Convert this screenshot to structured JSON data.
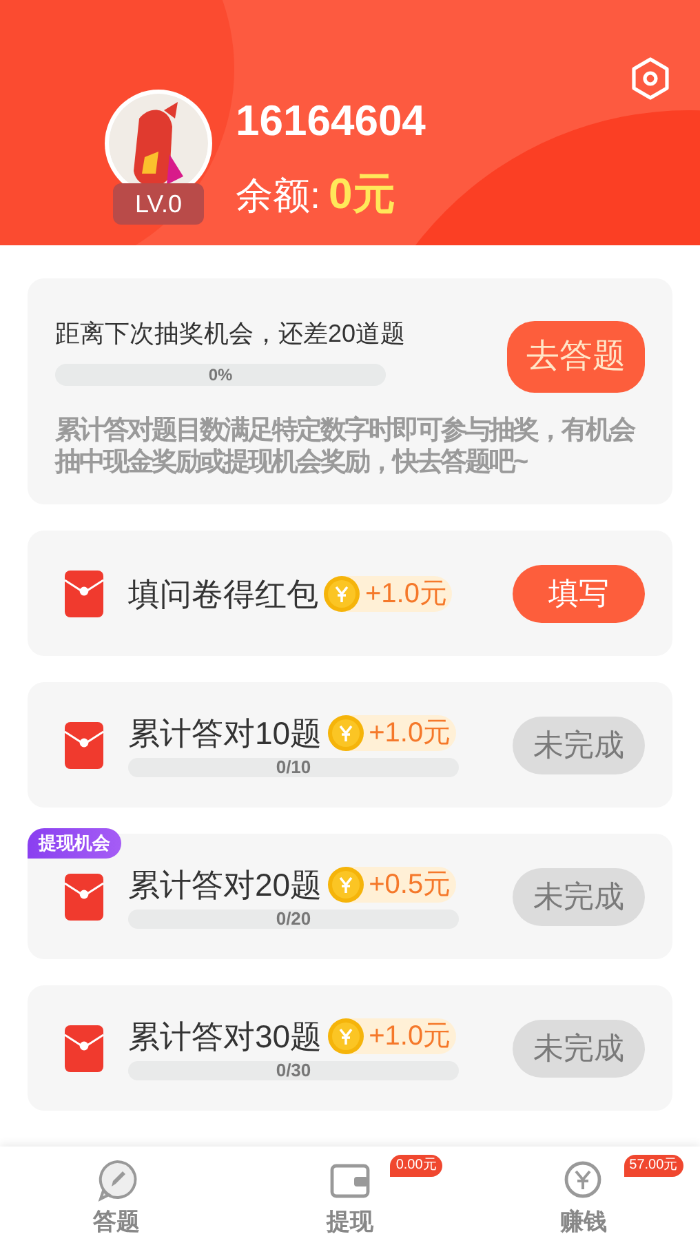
{
  "profile": {
    "user_id": "16164604",
    "level_badge": "LV.0",
    "balance_label": "余额:",
    "balance_value": "0元"
  },
  "lottery": {
    "title": "距离下次抽奖机会，还差20道题",
    "progress_text": "0%",
    "level": 0,
    "button": "去答题",
    "description": "累计答对题目数满足特定数字时即可参与抽奖，有机会抽中现金奖励或提现机会奖励，快去答题吧~"
  },
  "tasks": [
    {
      "kind": "survey",
      "title": "填问卷得红包",
      "reward": "+1.0元",
      "button": "填写",
      "disabled": false
    },
    {
      "kind": "progress",
      "title": "累计答对10题",
      "reward": "+1.0元",
      "progress_text": "0/10",
      "level": 0,
      "button": "未完成",
      "disabled": true
    },
    {
      "kind": "progress",
      "tag": "提现机会",
      "title": "累计答对20题",
      "reward": "+0.5元",
      "progress_text": "0/20",
      "level": 0,
      "button": "未完成",
      "disabled": true
    },
    {
      "kind": "progress",
      "title": "累计答对30题",
      "reward": "+1.0元",
      "progress_text": "0/30",
      "level": 0,
      "button": "未完成",
      "disabled": true
    }
  ],
  "bottom_nav": [
    {
      "kind": "quiz",
      "label": "答题"
    },
    {
      "kind": "wallet",
      "label": "提现",
      "badge": "0.00元"
    },
    {
      "kind": "earn",
      "label": "赚钱",
      "badge": "57.00元"
    }
  ]
}
